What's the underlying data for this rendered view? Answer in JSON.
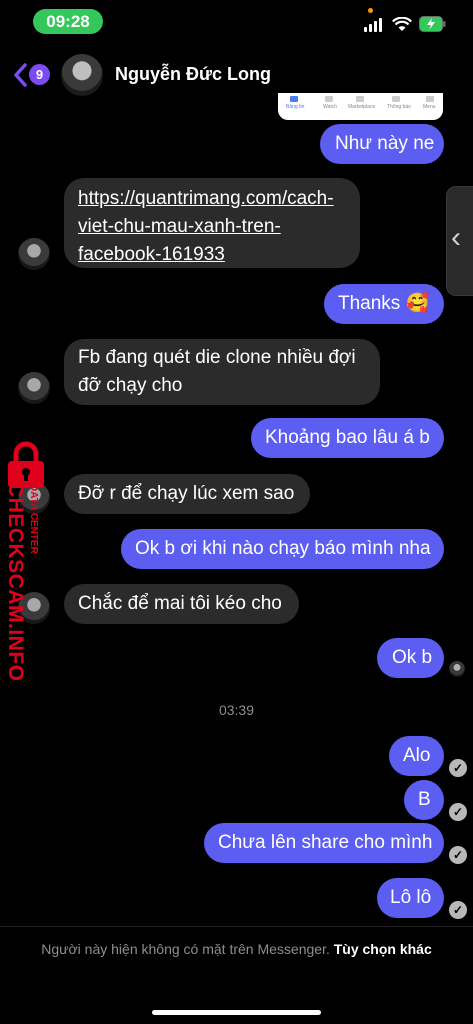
{
  "status_bar": {
    "time": "09:28"
  },
  "header": {
    "back_count": "9",
    "contact_name": "Nguyễn Đức Long"
  },
  "preview_tabs": [
    "Bảng tin",
    "Watch",
    "Marketplace",
    "Thông báo",
    "Menu"
  ],
  "messages": [
    {
      "dir": "out",
      "text": "Như này ne"
    },
    {
      "dir": "in",
      "lines": [
        "https://quantrimang.com/cach-",
        "viet-chu-mau-xanh-tren-",
        "facebook-161933"
      ]
    },
    {
      "dir": "out",
      "text": "Thanks 🥰"
    },
    {
      "dir": "in",
      "lines": [
        "Fb đang quét die clone nhiều đợi",
        "đỡ chạy cho"
      ]
    },
    {
      "dir": "out",
      "text": "Khoảng bao lâu á b"
    },
    {
      "dir": "in",
      "text": "Đỡ r để chạy lúc xem sao"
    },
    {
      "dir": "out",
      "text": "Ok b ơi khi nào chạy báo mình nha"
    },
    {
      "dir": "in",
      "text": "Chắc để mai tôi kéo cho"
    },
    {
      "dir": "out",
      "text": "Ok b"
    },
    {
      "dir": "out",
      "text": "Alo"
    },
    {
      "dir": "out",
      "text": "B"
    },
    {
      "dir": "out",
      "text": "Chưa lên share cho mình"
    },
    {
      "dir": "out",
      "text": "Lô lô"
    }
  ],
  "timestamp": "03:39",
  "watermark": {
    "main": "CHECKSCAM.INFO",
    "sub": "DATA CENTER"
  },
  "footer": {
    "notice": "Người này hiện không có mặt trên Messenger. ",
    "link": "Tùy chọn khác"
  },
  "colors": {
    "outgoing_bubble": "#5b5ef0",
    "incoming_bubble": "#2b2b2b",
    "accent": "#7b4cf0",
    "watermark": "#e0001b"
  }
}
